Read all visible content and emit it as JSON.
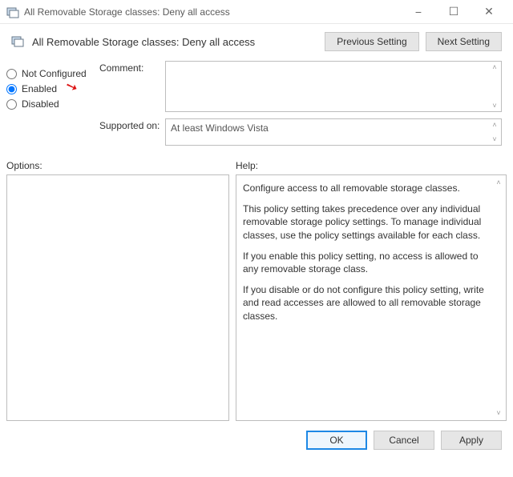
{
  "window": {
    "title": "All Removable Storage classes: Deny all access"
  },
  "header": {
    "policy_title": "All Removable Storage classes: Deny all access",
    "previous_label": "Previous Setting",
    "next_label": "Next Setting"
  },
  "radios": {
    "not_configured": "Not Configured",
    "enabled": "Enabled",
    "disabled": "Disabled",
    "selected": "enabled"
  },
  "fields": {
    "comment_label": "Comment:",
    "comment_value": "",
    "supported_label": "Supported on:",
    "supported_value": "At least Windows Vista"
  },
  "lower": {
    "options_label": "Options:",
    "help_label": "Help:"
  },
  "help": {
    "p1": "Configure access to all removable storage classes.",
    "p2": "This policy setting takes precedence over any individual removable storage policy settings. To manage individual classes, use the policy settings available for each class.",
    "p3": "If you enable this policy setting, no access is allowed to any removable storage class.",
    "p4": "If you disable or do not configure this policy setting, write and read accesses are allowed to all removable storage classes."
  },
  "footer": {
    "ok": "OK",
    "cancel": "Cancel",
    "apply": "Apply"
  }
}
